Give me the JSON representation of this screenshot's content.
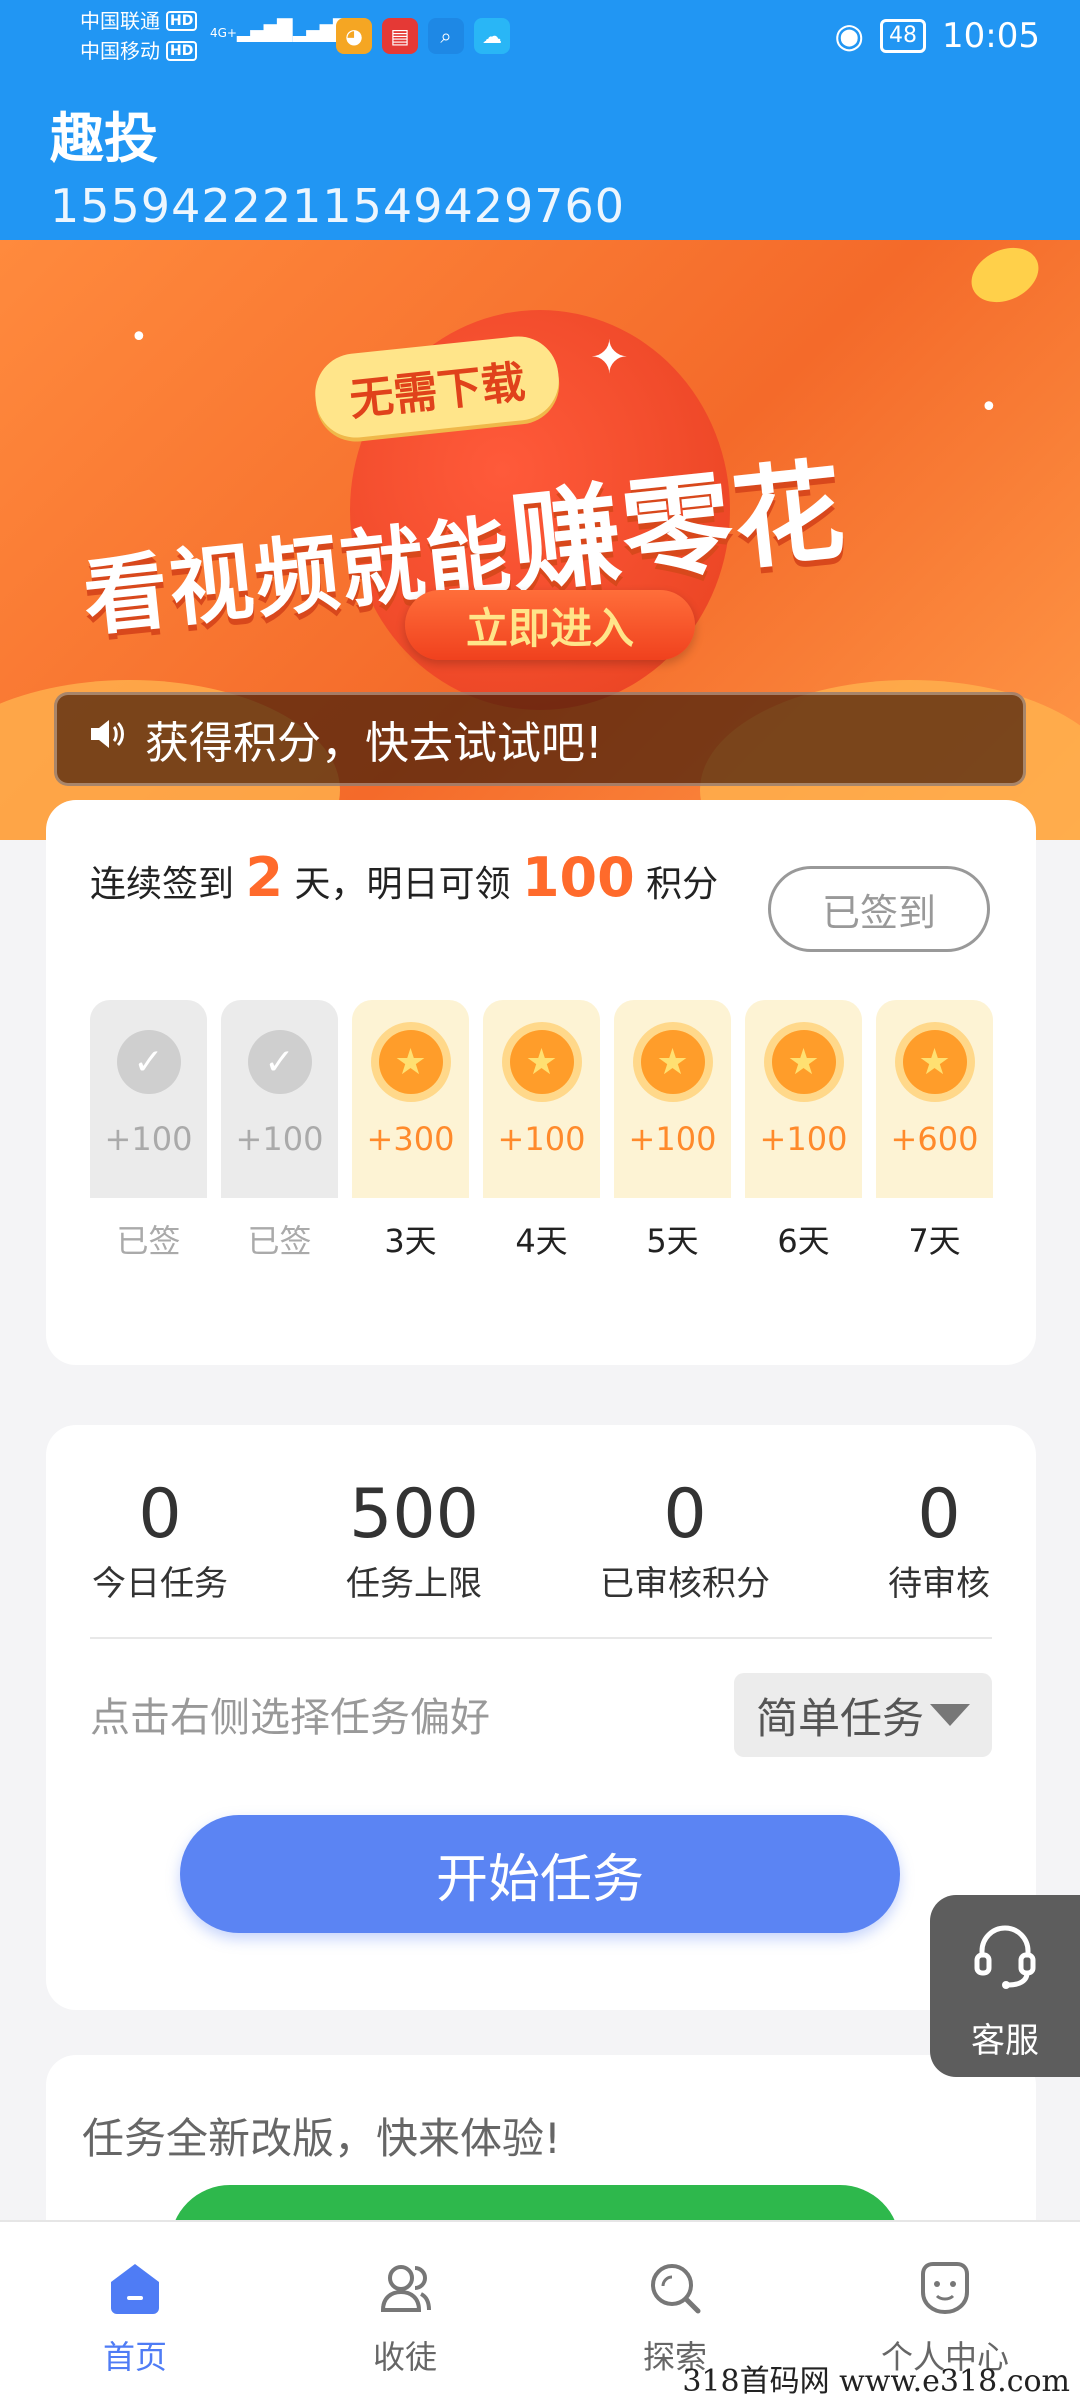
{
  "status_bar": {
    "carrier1": "中国联通",
    "carrier2": "中国移动",
    "hd": "HD",
    "net1": "4G+",
    "net2": "4G",
    "battery": "48",
    "time": "10:05"
  },
  "header": {
    "title": "趣投",
    "user_id": "1559422211549429760"
  },
  "banner": {
    "badge": "无需下载",
    "headline_part1": "看视频就能",
    "headline_part2": "赚零花",
    "button": "立即进入",
    "notice": "获得积分，快去试试吧!"
  },
  "signin": {
    "text_prefix": "连续签到",
    "streak_days": "2",
    "text_mid": "天，明日可领",
    "tomorrow_points": "100",
    "text_suffix": "积分",
    "signed_button": "已签到",
    "days": [
      {
        "points": "+100",
        "label": "已签"
      },
      {
        "points": "+100",
        "label": "已签"
      },
      {
        "points": "+300",
        "label": "3天"
      },
      {
        "points": "+100",
        "label": "4天"
      },
      {
        "points": "+100",
        "label": "5天"
      },
      {
        "points": "+100",
        "label": "6天"
      },
      {
        "points": "+600",
        "label": "7天"
      }
    ]
  },
  "tasks": {
    "stats": [
      {
        "value": "0",
        "label": "今日任务"
      },
      {
        "value": "500",
        "label": "任务上限"
      },
      {
        "value": "0",
        "label": "已审核积分"
      },
      {
        "value": "0",
        "label": "待审核"
      }
    ],
    "preference_hint": "点击右侧选择任务偏好",
    "preference_value": "简单任务",
    "start_button": "开始任务"
  },
  "promo": {
    "text": "任务全新改版，快来体验!"
  },
  "support": {
    "label": "客服"
  },
  "tabbar": {
    "items": [
      {
        "label": "首页",
        "icon": "home-icon",
        "active": true
      },
      {
        "label": "收徒",
        "icon": "users-icon",
        "active": false
      },
      {
        "label": "探索",
        "icon": "explore-icon",
        "active": false
      },
      {
        "label": "个人中心",
        "icon": "profile-icon",
        "active": false
      }
    ]
  },
  "watermark": "318首码网 www.e318.com",
  "colors": {
    "primary_blue": "#2196f3",
    "accent_orange": "#ff6a2b",
    "start_button_blue": "#5b84f3",
    "tab_active": "#4f7cf5"
  }
}
